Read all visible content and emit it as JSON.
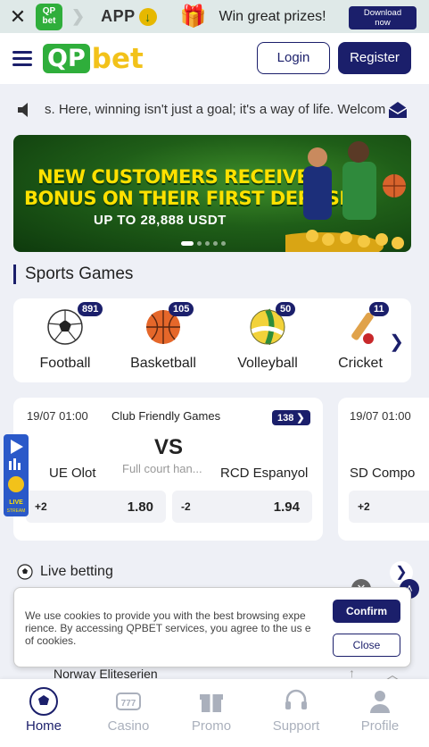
{
  "app_banner": {
    "mini_logo_top": "QP",
    "mini_logo_bottom": "bet",
    "app_label": "APP",
    "promo": "Win great prizes!",
    "download_line1": "Download",
    "download_line2": "now"
  },
  "header": {
    "logo_qp": "QP",
    "logo_bet": "bet",
    "login": "Login",
    "register": "Register"
  },
  "marquee": {
    "text": "s.  Here, winning isn't just a goal; it's a way of life.  Welcom"
  },
  "hero": {
    "line1": "NEW CUSTOMERS RECEIVE A",
    "line2": "BONUS ON THEIR FIRST DEPOSIT",
    "line3": "UP TO 28,888 USDT"
  },
  "sports_section": {
    "title": "Sports Games",
    "items": [
      {
        "label": "Football",
        "count": "891"
      },
      {
        "label": "Basketball",
        "count": "105"
      },
      {
        "label": "Volleyball",
        "count": "50"
      },
      {
        "label": "Cricket",
        "count": "11"
      }
    ]
  },
  "matches": [
    {
      "date": "19/07 01:00",
      "league": "Club Friendly Games",
      "count": "138",
      "vs": "VS",
      "home": "UE Olot",
      "status": "Full court han...",
      "away": "RCD Espanyol",
      "odds": [
        {
          "handicap": "+2",
          "price": "1.80"
        },
        {
          "handicap": "-2",
          "price": "1.94"
        }
      ]
    },
    {
      "date": "19/07 01:00",
      "home": "SD Compo",
      "odds": [
        {
          "handicap": "+2"
        }
      ]
    }
  ],
  "live_stream": {
    "label": "LIVE STREAM"
  },
  "live_betting": {
    "label": "Live betting"
  },
  "cookie": {
    "message": "We use cookies to provide you with the best browsing expe rience. By accessing QPBET services, you agree to the us e of cookies.",
    "confirm": "Confirm",
    "close": "Close"
  },
  "league_peek": {
    "name": "Norway Eliteserien"
  },
  "bottom_nav": [
    {
      "label": "Home",
      "active": true
    },
    {
      "label": "Casino"
    },
    {
      "label": "Promo"
    },
    {
      "label": "Support"
    },
    {
      "label": "Profile"
    }
  ],
  "colors": {
    "brand_navy": "#1b1f6b",
    "brand_green": "#2fae3b",
    "brand_yellow": "#f2c21a"
  }
}
